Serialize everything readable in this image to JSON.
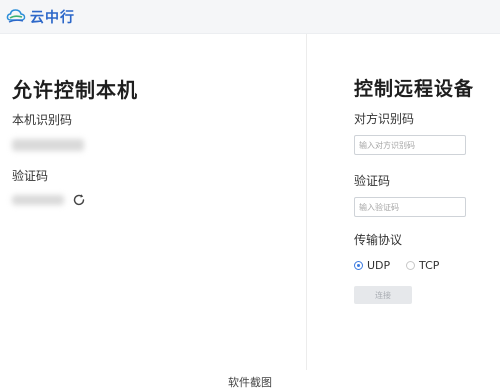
{
  "header": {
    "app_name": "云中行",
    "logo_icon": "cloud-logo-icon",
    "background_color": "#f5f6f8",
    "brand_color": "#2c67c9"
  },
  "left_panel": {
    "title": "允许控制本机",
    "id_label": "本机识别码",
    "code_label": "验证码",
    "refresh_icon": "refresh-icon"
  },
  "right_panel": {
    "title": "控制远程设备",
    "peer_id_label": "对方识别码",
    "peer_id_placeholder": "输入对方识别码",
    "peer_id_value": "",
    "code_label": "验证码",
    "code_placeholder": "输入验证码",
    "code_value": "",
    "protocol_label": "传输协议",
    "protocols": [
      {
        "label": "UDP",
        "selected": true
      },
      {
        "label": "TCP",
        "selected": false
      }
    ],
    "connect_label": "连接",
    "accent_color": "#3d7be0"
  },
  "caption": "软件截图"
}
